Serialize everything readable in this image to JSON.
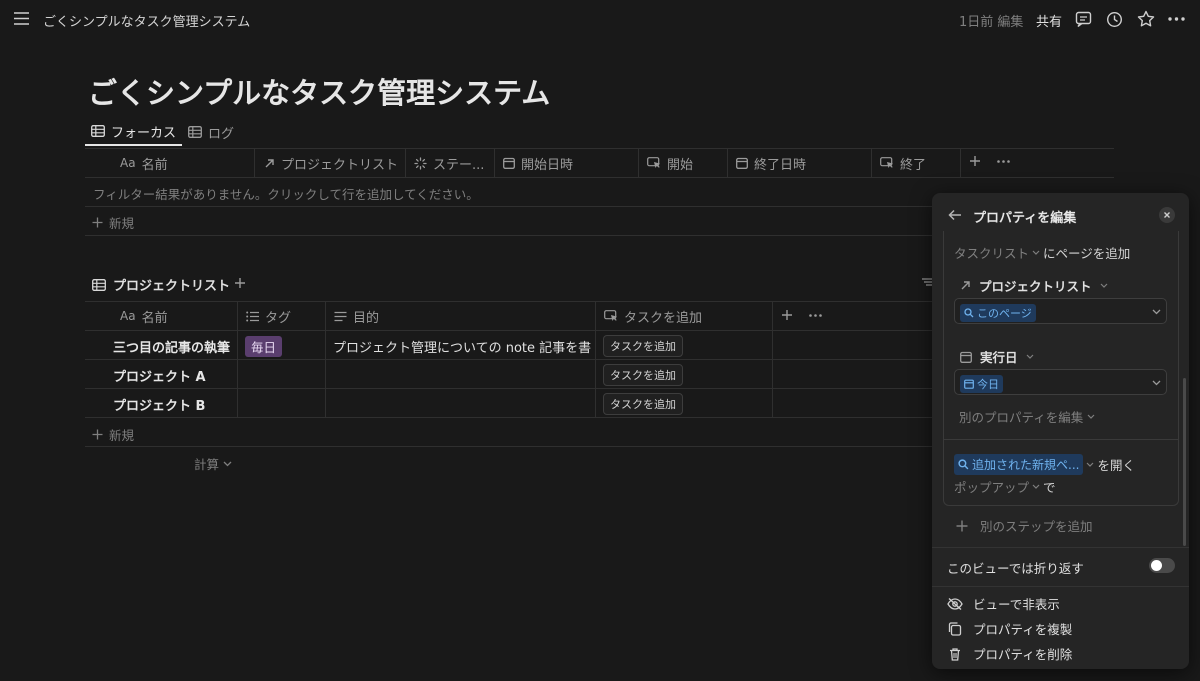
{
  "topbar": {
    "breadcrumb": "ごくシンプルなタスク管理システム",
    "edited": "1日前 編集",
    "share": "共有"
  },
  "page": {
    "title": "ごくシンプルなタスク管理システム"
  },
  "tabs": [
    {
      "label": "フォーカス"
    },
    {
      "label": "ログ"
    }
  ],
  "focus_table": {
    "columns": [
      {
        "label": "名前",
        "prefix": "Aa"
      },
      {
        "label": "プロジェクトリスト"
      },
      {
        "label": "ステー..."
      },
      {
        "label": "開始日時"
      },
      {
        "label": "開始"
      },
      {
        "label": "終了日時"
      },
      {
        "label": "終了"
      }
    ],
    "empty_message": "フィルター結果がありません。クリックして行を追加してください。",
    "new_label": "新規"
  },
  "project_table": {
    "title": "プロジェクトリスト",
    "columns": [
      {
        "label": "名前",
        "prefix": "Aa"
      },
      {
        "label": "タグ"
      },
      {
        "label": "目的"
      },
      {
        "label": "タスクを追加"
      }
    ],
    "rows": [
      {
        "name": "三つ目の記事の執筆",
        "tag": "毎日",
        "purpose": "プロジェクト管理についての note 記事を書く",
        "button": "タスクを追加"
      },
      {
        "name": "プロジェクト A",
        "tag": "",
        "purpose": "",
        "button": "タスクを追加"
      },
      {
        "name": "プロジェクト B",
        "tag": "",
        "purpose": "",
        "button": "タスクを追加"
      }
    ],
    "new_label": "新規",
    "calc_label": "計算"
  },
  "panel": {
    "title": "プロパティを編集",
    "add_page_db": "タスクリスト",
    "add_page_suffix": "にページを追加",
    "prop1_label": "プロジェクトリスト",
    "prop1_value": "このページ",
    "prop2_label": "実行日",
    "prop2_value": "今日",
    "edit_other": "別のプロパティを編集",
    "open_value": "追加された新規ペ...",
    "open_suffix": "を開く",
    "popup_value": "ポップアップ",
    "popup_suffix": "で",
    "add_step": "別のステップを追加",
    "wrap_label": "このビューでは折り返す",
    "wrap_on": false,
    "menu": [
      {
        "label": "ビューで非表示",
        "icon": "eye-off-icon"
      },
      {
        "label": "プロパティを複製",
        "icon": "duplicate-icon"
      },
      {
        "label": "プロパティを削除",
        "icon": "trash-icon"
      }
    ]
  },
  "colors": {
    "background": "#191919",
    "panel": "#252525",
    "tag_purple": "#5a3e6e",
    "link_blue": "#6fb2ee"
  }
}
